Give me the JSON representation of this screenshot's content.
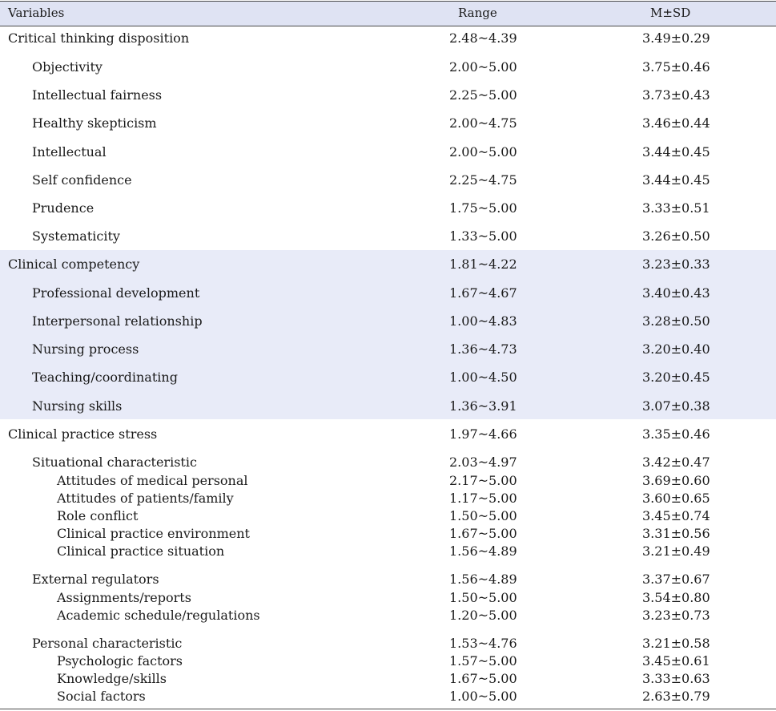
{
  "headers": {
    "variables": "Variables",
    "range": "Range",
    "msd": "M±SD"
  },
  "rows": [
    {
      "label": "Critical thinking disposition",
      "range": "2.48~4.39",
      "msd": "3.49±0.29",
      "level": 0
    },
    {
      "label": "Objectivity",
      "range": "2.00~5.00",
      "msd": "3.75±0.46",
      "level": 1
    },
    {
      "label": "Intellectual fairness",
      "range": "2.25~5.00",
      "msd": "3.73±0.43",
      "level": 1
    },
    {
      "label": "Healthy skepticism",
      "range": "2.00~4.75",
      "msd": "3.46±0.44",
      "level": 1
    },
    {
      "label": "Intellectual",
      "range": "2.00~5.00",
      "msd": "3.44±0.45",
      "level": 1
    },
    {
      "label": "Self confidence",
      "range": "2.25~4.75",
      "msd": "3.44±0.45",
      "level": 1
    },
    {
      "label": "Prudence",
      "range": "1.75~5.00",
      "msd": "3.33±0.51",
      "level": 1
    },
    {
      "label": "Systematicity",
      "range": "1.33~5.00",
      "msd": "3.26±0.50",
      "level": 1
    },
    {
      "label": "Clinical competency",
      "range": "1.81~4.22",
      "msd": "3.23±0.33",
      "level": 0
    },
    {
      "label": "Professional development",
      "range": "1.67~4.67",
      "msd": "3.40±0.43",
      "level": 1
    },
    {
      "label": "Interpersonal relationship",
      "range": "1.00~4.83",
      "msd": "3.28±0.50",
      "level": 1
    },
    {
      "label": "Nursing process",
      "range": "1.36~4.73",
      "msd": "3.20±0.40",
      "level": 1
    },
    {
      "label": "Teaching/coordinating",
      "range": "1.00~4.50",
      "msd": "3.20±0.45",
      "level": 1
    },
    {
      "label": "Nursing skills",
      "range": "1.36~3.91",
      "msd": "3.07±0.38",
      "level": 1
    },
    {
      "label": "Clinical practice stress",
      "range": "1.97~4.66",
      "msd": "3.35±0.46",
      "level": 0
    },
    {
      "label": "Situational characteristic",
      "range": "2.03~4.97",
      "msd": "3.42±0.47",
      "level": 1
    },
    {
      "label": "Attitudes of medical personal",
      "range": "2.17~5.00",
      "msd": "3.69±0.60",
      "level": 2
    },
    {
      "label": "Attitudes of patients/family",
      "range": "1.17~5.00",
      "msd": "3.60±0.65",
      "level": 2
    },
    {
      "label": "Role conflict",
      "range": "1.50~5.00",
      "msd": "3.45±0.74",
      "level": 2
    },
    {
      "label": "Clinical practice environment",
      "range": "1.67~5.00",
      "msd": "3.31±0.56",
      "level": 2
    },
    {
      "label": "Clinical practice situation",
      "range": "1.56~4.89",
      "msd": "3.21±0.49",
      "level": 2
    },
    {
      "label": "External regulators",
      "range": "1.56~4.89",
      "msd": "3.37±0.67",
      "level": 1
    },
    {
      "label": "Assignments/reports",
      "range": "1.50~5.00",
      "msd": "3.54±0.80",
      "level": 2
    },
    {
      "label": "Academic schedule/regulations",
      "range": "1.20~5.00",
      "msd": "3.23±0.73",
      "level": 2
    },
    {
      "label": "Personal characteristic",
      "range": "1.53~4.76",
      "msd": "3.21±0.58",
      "level": 1
    },
    {
      "label": "Psychologic factors",
      "range": "1.57~5.00",
      "msd": "3.45±0.61",
      "level": 2
    },
    {
      "label": "Knowledge/skills",
      "range": "1.67~5.00",
      "msd": "3.33±0.63",
      "level": 2
    },
    {
      "label": "Social factors",
      "range": "1.00~5.00",
      "msd": "2.63±0.79",
      "level": 2
    }
  ],
  "colors": {
    "header_bg": "#dfe3f3",
    "band_bg": "#e8ebf8",
    "rule": "#4a4a4a"
  }
}
